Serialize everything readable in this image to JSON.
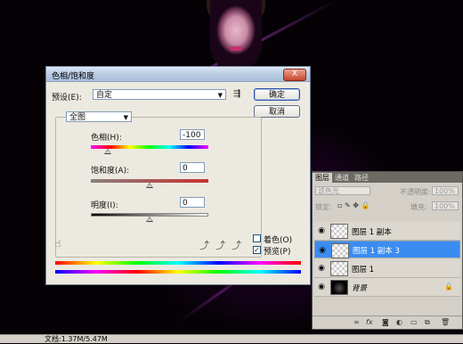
{
  "dialog": {
    "title": "色相/饱和度",
    "close_label": "X",
    "preset_label": "预设(E):",
    "preset_value": "自定",
    "ok_label": "确定",
    "cancel_label": "取消",
    "channel_value": "全图",
    "hue_label": "色相(H):",
    "hue_value": "-100",
    "saturation_label": "饱和度(A):",
    "saturation_value": "0",
    "lightness_label": "明度(I):",
    "lightness_value": "0",
    "colorize_label": "着色(O)",
    "colorize_checked": false,
    "preview_label": "预览(P)",
    "preview_checked": true,
    "preview_check_glyph": "✓"
  },
  "layers_panel": {
    "tabs": [
      "图层",
      "通道",
      "路径"
    ],
    "blend_mode": "滤色光",
    "opacity_label": "不透明度:",
    "opacity_value": "100%",
    "lock_label": "锁定:",
    "fill_label": "填充:",
    "fill_value": "100%",
    "layers": [
      {
        "name": "图层 1 副本",
        "selected": false,
        "visible": true,
        "dark": false,
        "locked": false
      },
      {
        "name": "图层 1 副本 3",
        "selected": true,
        "visible": true,
        "dark": false,
        "locked": false
      },
      {
        "name": "图层 1",
        "selected": false,
        "visible": true,
        "dark": false,
        "locked": false
      },
      {
        "name": "背景",
        "selected": false,
        "visible": true,
        "dark": true,
        "locked": true
      }
    ]
  },
  "status_bar": {
    "doc_info": "文档:1.37M/5.47M"
  }
}
